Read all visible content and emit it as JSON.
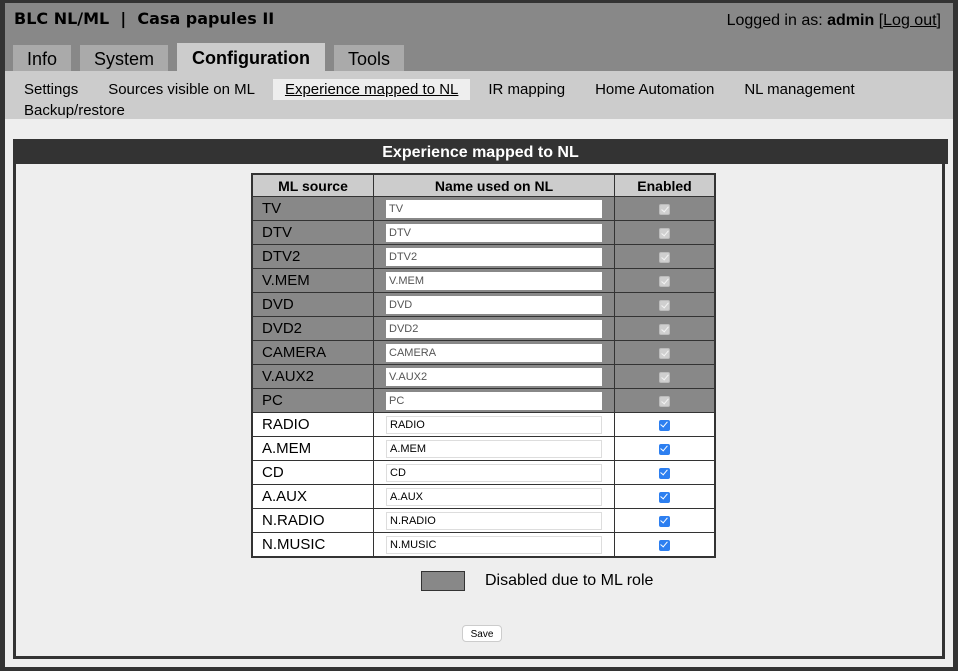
{
  "header": {
    "app_title": "BLC NL/ML  |  Casa papules II",
    "login_prefix": "Logged in as: ",
    "username": "admin",
    "logout_open": "[",
    "logout_label": "Log out",
    "logout_close": "]"
  },
  "tabs": [
    {
      "label": "Info",
      "active": false
    },
    {
      "label": "System",
      "active": false
    },
    {
      "label": "Configuration",
      "active": true
    },
    {
      "label": "Tools",
      "active": false
    }
  ],
  "subnav": [
    {
      "label": "Settings",
      "active": false
    },
    {
      "label": "Sources visible on ML",
      "active": false
    },
    {
      "label": "Experience mapped to NL",
      "active": true
    },
    {
      "label": "IR mapping",
      "active": false
    },
    {
      "label": "Home Automation",
      "active": false
    },
    {
      "label": "NL management",
      "active": false
    },
    {
      "label": "Backup/restore",
      "active": false
    }
  ],
  "panel": {
    "title": "Experience mapped to NL",
    "columns": [
      "ML source",
      "Name used on NL",
      "Enabled"
    ],
    "rows": [
      {
        "source": "TV",
        "name": "TV",
        "enabled": true,
        "disabled": true
      },
      {
        "source": "DTV",
        "name": "DTV",
        "enabled": true,
        "disabled": true
      },
      {
        "source": "DTV2",
        "name": "DTV2",
        "enabled": true,
        "disabled": true
      },
      {
        "source": "V.MEM",
        "name": "V.MEM",
        "enabled": true,
        "disabled": true
      },
      {
        "source": "DVD",
        "name": "DVD",
        "enabled": true,
        "disabled": true
      },
      {
        "source": "DVD2",
        "name": "DVD2",
        "enabled": true,
        "disabled": true
      },
      {
        "source": "CAMERA",
        "name": "CAMERA",
        "enabled": true,
        "disabled": true
      },
      {
        "source": "V.AUX2",
        "name": "V.AUX2",
        "enabled": true,
        "disabled": true
      },
      {
        "source": "PC",
        "name": "PC",
        "enabled": true,
        "disabled": true
      },
      {
        "source": "RADIO",
        "name": "RADIO",
        "enabled": true,
        "disabled": false
      },
      {
        "source": "A.MEM",
        "name": "A.MEM",
        "enabled": true,
        "disabled": false
      },
      {
        "source": "CD",
        "name": "CD",
        "enabled": true,
        "disabled": false
      },
      {
        "source": "A.AUX",
        "name": "A.AUX",
        "enabled": true,
        "disabled": false
      },
      {
        "source": "N.RADIO",
        "name": "N.RADIO",
        "enabled": true,
        "disabled": false
      },
      {
        "source": "N.MUSIC",
        "name": "N.MUSIC",
        "enabled": true,
        "disabled": false
      }
    ],
    "legend_text": "Disabled due to ML role",
    "legend_color": "#888888",
    "save_label": "Save"
  }
}
